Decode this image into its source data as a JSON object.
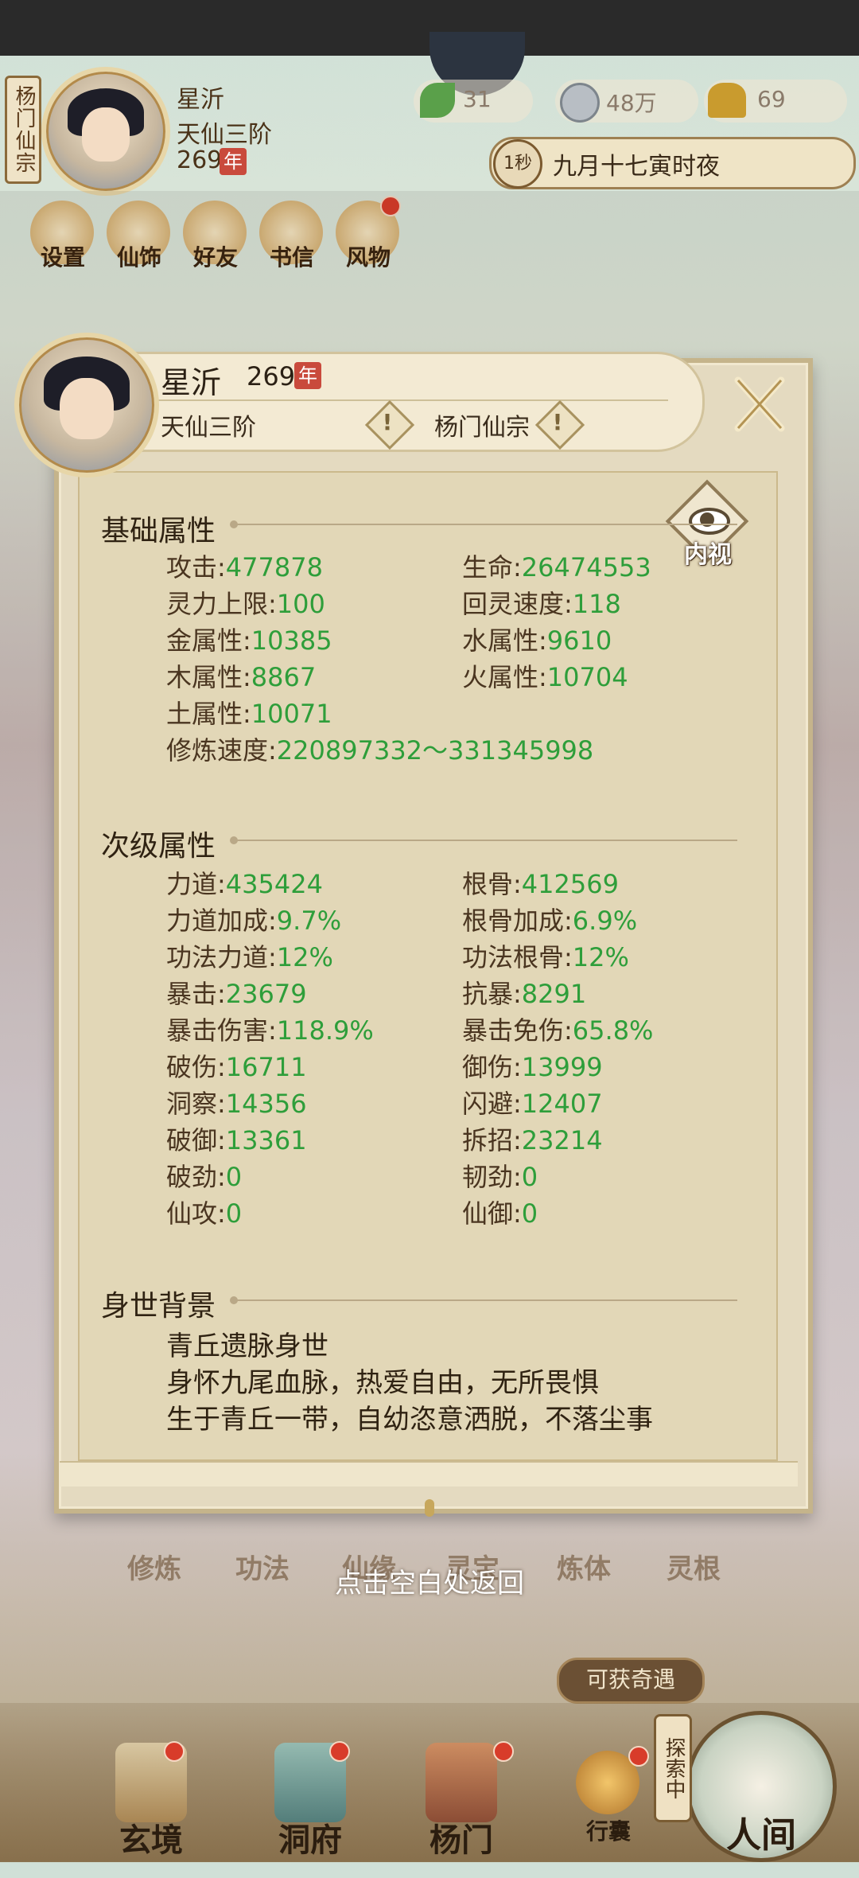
{
  "top": {
    "sect_vertical": "杨门仙宗",
    "player_name": "星沂",
    "realm": "天仙三阶",
    "age": "269",
    "age_unit": "年",
    "resources": [
      {
        "icon": "leaf-icon",
        "value": "31"
      },
      {
        "icon": "coin-icon",
        "value": "48万"
      },
      {
        "icon": "strength-icon",
        "value": "69"
      }
    ],
    "time_speed": "1秒",
    "time_text": "九月十七寅时夜",
    "toolbar": [
      "设置",
      "仙饰",
      "好友",
      "书信",
      "风物"
    ]
  },
  "panel": {
    "name": "星沂",
    "age": "269",
    "age_unit": "年",
    "realm": "天仙三阶",
    "sect": "杨门仙宗",
    "inner_view": "内视",
    "basic": {
      "title": "基础属性",
      "rows": [
        [
          {
            "k": "攻击",
            "v": "477878"
          },
          {
            "k": "生命",
            "v": "26474553"
          }
        ],
        [
          {
            "k": "灵力上限",
            "v": "100"
          },
          {
            "k": "回灵速度",
            "v": "118"
          }
        ],
        [
          {
            "k": "金属性",
            "v": "10385"
          },
          {
            "k": "水属性",
            "v": "9610"
          }
        ],
        [
          {
            "k": "木属性",
            "v": "8867"
          },
          {
            "k": "火属性",
            "v": "10704"
          }
        ],
        [
          {
            "k": "土属性",
            "v": "10071"
          }
        ],
        [
          {
            "k": "修炼速度",
            "v": "220897332～331345998"
          }
        ]
      ]
    },
    "secondary": {
      "title": "次级属性",
      "rows": [
        [
          {
            "k": "力道",
            "v": "435424"
          },
          {
            "k": "根骨",
            "v": "412569"
          }
        ],
        [
          {
            "k": "力道加成",
            "v": "9.7%"
          },
          {
            "k": "根骨加成",
            "v": "6.9%"
          }
        ],
        [
          {
            "k": "功法力道",
            "v": "12%"
          },
          {
            "k": "功法根骨",
            "v": "12%"
          }
        ],
        [
          {
            "k": "暴击",
            "v": "23679"
          },
          {
            "k": "抗暴",
            "v": "8291"
          }
        ],
        [
          {
            "k": "暴击伤害",
            "v": "118.9%"
          },
          {
            "k": "暴击免伤",
            "v": "65.8%"
          }
        ],
        [
          {
            "k": "破伤",
            "v": "16711"
          },
          {
            "k": "御伤",
            "v": "13999"
          }
        ],
        [
          {
            "k": "洞察",
            "v": "14356"
          },
          {
            "k": "闪避",
            "v": "12407"
          }
        ],
        [
          {
            "k": "破御",
            "v": "13361"
          },
          {
            "k": "拆招",
            "v": "23214"
          }
        ],
        [
          {
            "k": "破劲",
            "v": "0"
          },
          {
            "k": "韧劲",
            "v": "0"
          }
        ],
        [
          {
            "k": "仙攻",
            "v": "0"
          },
          {
            "k": "仙御",
            "v": "0"
          }
        ]
      ]
    },
    "background": {
      "title": "身世背景",
      "lines": [
        "青丘遗脉身世",
        "身怀九尾血脉，热爱自由，无所畏惧",
        "生于青丘一带，自幼恣意洒脱，不落尘事"
      ]
    }
  },
  "bg_buttons": [
    "修炼",
    "功法",
    "仙缘",
    "灵宝",
    "炼体",
    "灵根"
  ],
  "hint": "点击空白处返回",
  "qiyu": "可获奇遇",
  "explore_tag": "探索中",
  "bottom_nav": [
    {
      "label": "玄境",
      "icon": "scroll-icon"
    },
    {
      "label": "洞府",
      "icon": "pavilion-icon"
    },
    {
      "label": "杨门",
      "icon": "banner-icon"
    },
    {
      "label": "行囊",
      "icon": "bag-icon"
    },
    {
      "label": "人间",
      "icon": "world-icon"
    }
  ]
}
